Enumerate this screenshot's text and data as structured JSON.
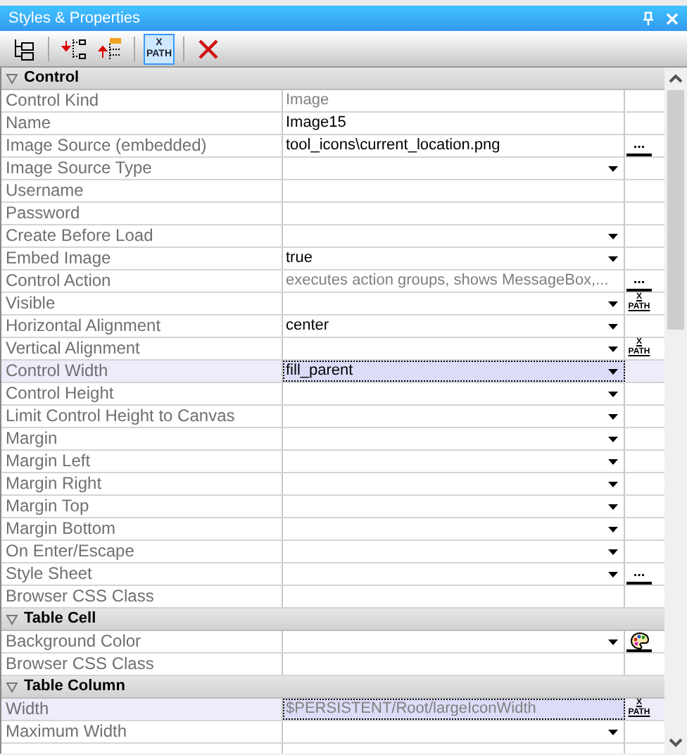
{
  "window": {
    "title": "Styles & Properties"
  },
  "toolbar": [
    {
      "kind": "tree"
    },
    {
      "kind": "move-down"
    },
    {
      "kind": "move-up"
    },
    {
      "kind": "xpath",
      "top": "X",
      "bottom": "PATH",
      "selected": true
    },
    {
      "kind": "delete"
    }
  ],
  "sections": [
    {
      "title": "Control",
      "expanded": true,
      "rows": [
        {
          "label": "Control Kind",
          "value": "Image",
          "greyed": true,
          "dropdown": false,
          "selected": false
        },
        {
          "label": "Name",
          "value": "Image15",
          "greyed": false,
          "dropdown": false,
          "selected": false
        },
        {
          "label": "Image Source (embedded)",
          "value": "tool_icons\\current_location.png",
          "greyed": false,
          "dropdown": false,
          "selected": false,
          "button": {
            "kind": "ellipsis",
            "text": "..."
          }
        },
        {
          "label": "Image Source Type",
          "value": "",
          "greyed": false,
          "dropdown": true,
          "selected": false
        },
        {
          "label": "Username",
          "value": "",
          "greyed": false,
          "dropdown": false,
          "selected": false
        },
        {
          "label": "Password",
          "value": "",
          "greyed": false,
          "dropdown": false,
          "selected": false
        },
        {
          "label": "Create Before Load",
          "value": "",
          "greyed": false,
          "dropdown": true,
          "selected": false
        },
        {
          "label": "Embed Image",
          "value": "true",
          "greyed": false,
          "dropdown": true,
          "selected": false
        },
        {
          "label": "Control Action",
          "value": "executes action groups, shows MessageBox,...",
          "greyed": true,
          "dropdown": false,
          "selected": false,
          "button": {
            "kind": "ellipsis",
            "text": "..."
          }
        },
        {
          "label": "Visible",
          "value": "",
          "greyed": false,
          "dropdown": true,
          "selected": false,
          "button": {
            "kind": "xpath",
            "top": "X",
            "bottom": "PATH"
          }
        },
        {
          "label": "Horizontal Alignment",
          "value": "center",
          "greyed": false,
          "dropdown": true,
          "selected": false
        },
        {
          "label": "Vertical Alignment",
          "value": "",
          "greyed": false,
          "dropdown": true,
          "selected": false,
          "button": {
            "kind": "xpath",
            "top": "X",
            "bottom": "PATH"
          }
        },
        {
          "label": "Control Width",
          "value": "fill_parent",
          "greyed": false,
          "dropdown": true,
          "selected": true
        },
        {
          "label": "Control Height",
          "value": "",
          "greyed": false,
          "dropdown": true,
          "selected": false
        },
        {
          "label": "Limit Control Height to Canvas",
          "value": "",
          "greyed": false,
          "dropdown": true,
          "selected": false
        },
        {
          "label": "Margin",
          "value": "",
          "greyed": false,
          "dropdown": true,
          "selected": false
        },
        {
          "label": "Margin Left",
          "value": "",
          "greyed": false,
          "dropdown": true,
          "selected": false
        },
        {
          "label": "Margin Right",
          "value": "",
          "greyed": false,
          "dropdown": true,
          "selected": false
        },
        {
          "label": "Margin Top",
          "value": "",
          "greyed": false,
          "dropdown": true,
          "selected": false
        },
        {
          "label": "Margin Bottom",
          "value": "",
          "greyed": false,
          "dropdown": true,
          "selected": false
        },
        {
          "label": "On Enter/Escape",
          "value": "",
          "greyed": false,
          "dropdown": true,
          "selected": false
        },
        {
          "label": "Style Sheet",
          "value": "",
          "greyed": false,
          "dropdown": true,
          "selected": false,
          "button": {
            "kind": "ellipsis",
            "text": "..."
          }
        },
        {
          "label": "Browser CSS Class",
          "value": "",
          "greyed": false,
          "dropdown": false,
          "selected": false
        }
      ]
    },
    {
      "title": "Table Cell",
      "expanded": true,
      "rows": [
        {
          "label": "Background Color",
          "value": "",
          "greyed": false,
          "dropdown": true,
          "selected": false,
          "button": {
            "kind": "palette"
          }
        },
        {
          "label": "Browser CSS Class",
          "value": "",
          "greyed": false,
          "dropdown": false,
          "selected": false
        }
      ]
    },
    {
      "title": "Table Column",
      "expanded": true,
      "rows": [
        {
          "label": "Width",
          "value": "$PERSISTENT/Root/largeIconWidth",
          "greyed": true,
          "dropdown": false,
          "selected": true,
          "button": {
            "kind": "xpath",
            "top": "X",
            "bottom": "PATH"
          }
        },
        {
          "label": "Maximum Width",
          "value": "",
          "greyed": false,
          "dropdown": true,
          "selected": false
        }
      ]
    }
  ]
}
